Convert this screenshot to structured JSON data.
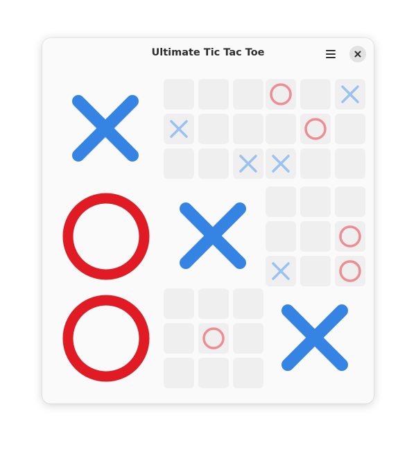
{
  "window": {
    "title": "Ultimate Tic Tac Toe",
    "menu_icon": "hamburger-menu-icon",
    "close_icon": "close-icon"
  },
  "colors": {
    "x": "#3584e4",
    "o": "#e01b24",
    "x_small": "#99c1f1",
    "o_small": "#ed8d91",
    "cell": "#efefef"
  },
  "boards": [
    {
      "winner": "X",
      "cells": [
        "",
        "",
        "",
        "",
        "",
        "",
        "",
        "",
        ""
      ]
    },
    {
      "winner": "",
      "cells": [
        "",
        "",
        "",
        "X",
        "",
        "",
        "",
        "",
        "X"
      ]
    },
    {
      "winner": "",
      "cells": [
        "O",
        "",
        "X",
        "",
        "O",
        "",
        "X",
        "",
        ""
      ]
    },
    {
      "winner": "O",
      "cells": [
        "",
        "",
        "",
        "",
        "",
        "",
        "",
        "",
        ""
      ]
    },
    {
      "winner": "X",
      "cells": [
        "",
        "",
        "",
        "",
        "",
        "",
        "",
        "",
        ""
      ]
    },
    {
      "winner": "",
      "cells": [
        "",
        "",
        "",
        "",
        "",
        "O",
        "X",
        "",
        "O"
      ]
    },
    {
      "winner": "O",
      "cells": [
        "",
        "",
        "",
        "",
        "",
        "",
        "",
        "",
        ""
      ]
    },
    {
      "winner": "",
      "cells": [
        "",
        "",
        "",
        "",
        "O",
        "",
        "",
        "",
        ""
      ]
    },
    {
      "winner": "X",
      "cells": [
        "",
        "",
        "",
        "",
        "",
        "",
        "",
        "",
        ""
      ]
    }
  ]
}
